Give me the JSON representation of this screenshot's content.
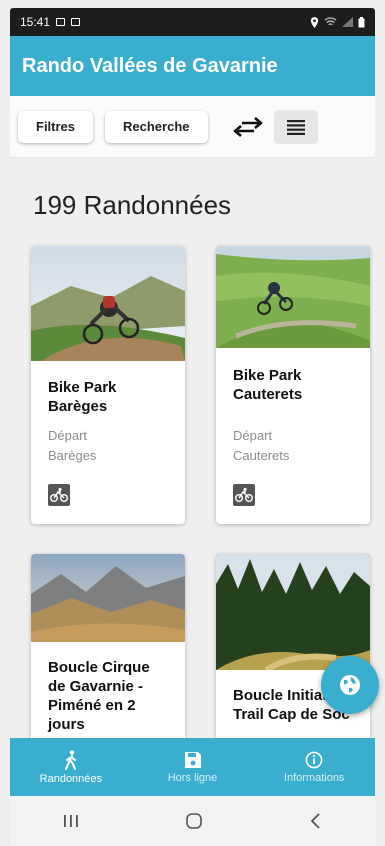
{
  "status": {
    "time": "15:41"
  },
  "app": {
    "title": "Rando Vallées de Gavarnie"
  },
  "toolbar": {
    "filters_label": "Filtres",
    "search_label": "Recherche"
  },
  "list": {
    "count_title": "199 Randonnées"
  },
  "cards": [
    {
      "name_lines": [
        "Bike Park",
        "Barèges"
      ],
      "depart_label": "Départ",
      "depart_place": "Barèges",
      "activity": "cycling-icon"
    },
    {
      "name_lines": [
        "Bike Park",
        "Cauterets"
      ],
      "depart_label": "Départ",
      "depart_place": "Cauterets",
      "activity": "cycling-icon"
    },
    {
      "name_lines": [
        "Boucle Cirque",
        "de Gavarnie -",
        "Piméné en 2",
        "jours"
      ]
    },
    {
      "name_lines": [
        "Boucle Initiat",
        "Trail Cap de Soc"
      ]
    }
  ],
  "bottom_nav": [
    {
      "label": "Randonnées",
      "icon": "hiker-icon",
      "active": true
    },
    {
      "label": "Hors ligne",
      "icon": "save-icon",
      "active": false
    },
    {
      "label": "Informations",
      "icon": "info-icon",
      "active": false
    }
  ],
  "colors": {
    "primary": "#3aaecf",
    "background": "#efefef"
  }
}
